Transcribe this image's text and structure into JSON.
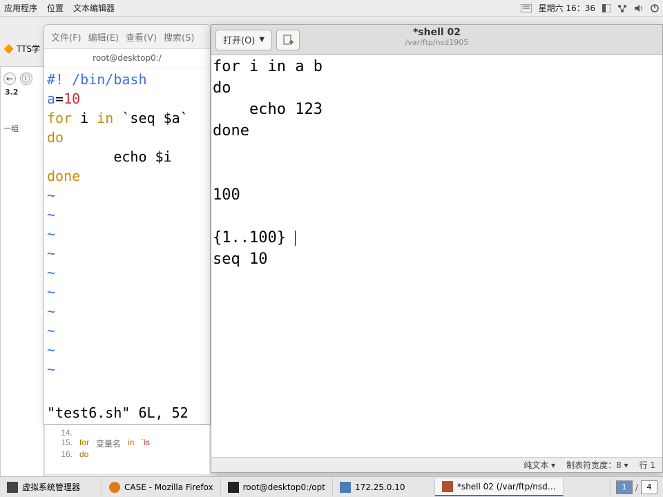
{
  "topbar": {
    "menu": [
      "应用程序",
      "位置",
      "文本编辑器"
    ],
    "clock": "星期六 16：36"
  },
  "bg": {
    "tab_title_fragment": "TTS学",
    "sec_num": "3.2",
    "sidebar_fragment": "一组"
  },
  "vim": {
    "menubar": [
      "文件(F)",
      "编辑(E)",
      "查看(V)",
      "搜索(S)"
    ],
    "title_fragment": "root@desktop0:/",
    "code": {
      "l1a": "#! /bin/bash",
      "l2_lhs": "a",
      "l2_eq": "=",
      "l2_num": "10",
      "l3_for": "for",
      "l3_mid": " i ",
      "l3_in": "in",
      "l3_tail": " `seq $a`",
      "l4": "do",
      "l5_pad": "        ",
      "l5_body": "echo $i",
      "l6": "done"
    },
    "tilde": "~",
    "status": "\"test6.sh\"  6L,  52"
  },
  "gedit": {
    "open_label": "打开(O)",
    "title": "*shell 02",
    "subtitle": "/var/ftp/nsd1905",
    "lines": [
      "for i in a b",
      "do",
      "    echo 123",
      "done",
      "",
      "",
      "100",
      "",
      "{1..100}",
      "seq 10"
    ],
    "status": {
      "mode": "纯文本 ▾",
      "tabwidth": "制表符宽度：8 ▾",
      "lineinfo": "行 1"
    }
  },
  "doc_peek": {
    "n14": "14.",
    "n15": "15.",
    "l15a": "for",
    "l15b": "变量名",
    "l15c": "in",
    "l15d": "`ls",
    "n16": "16.",
    "l16": "do"
  },
  "taskbar": {
    "items": [
      {
        "label": "虚拟系统管理器",
        "icon": "vm"
      },
      {
        "label": "CASE - Mozilla Firefox",
        "icon": "ff"
      },
      {
        "label": "root@desktop0:/opt",
        "icon": "term"
      },
      {
        "label": "172.25.0.10",
        "icon": "vnc"
      },
      {
        "label": "*shell 02 (/var/ftp/nsd…",
        "icon": "ed"
      }
    ],
    "ws_current": "1",
    "ws_total": "4"
  }
}
